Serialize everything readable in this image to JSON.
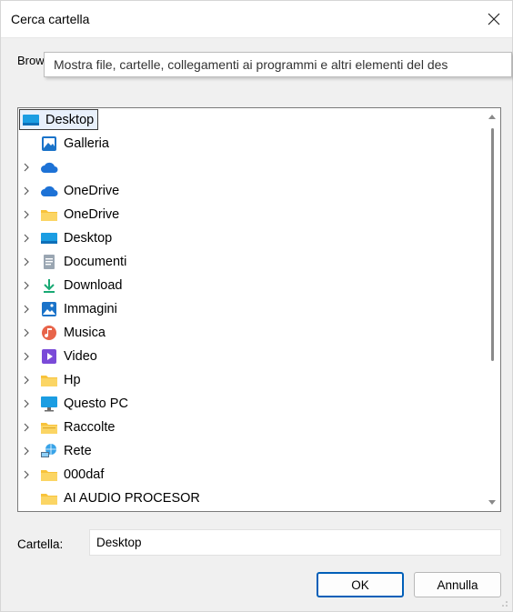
{
  "window": {
    "title": "Cerca cartella",
    "close_icon": "close-icon"
  },
  "prompt": "Browse For Folder",
  "tree": {
    "root": {
      "label": "Desktop",
      "icon": "desktop-icon",
      "selected": true
    },
    "items": [
      {
        "label": "Galleria",
        "icon": "gallery-icon",
        "expandable": false
      },
      {
        "label": "",
        "icon": "onedrive-cloud-icon",
        "expandable": true,
        "hidden_by_tooltip": true
      },
      {
        "label": "OneDrive",
        "icon": "onedrive-cloud-icon",
        "expandable": true
      },
      {
        "label": "OneDrive",
        "icon": "folder-icon",
        "expandable": true
      },
      {
        "label": "Desktop",
        "icon": "desktop-icon",
        "expandable": true
      },
      {
        "label": "Documenti",
        "icon": "documents-icon",
        "expandable": true
      },
      {
        "label": "Download",
        "icon": "download-icon",
        "expandable": true
      },
      {
        "label": "Immagini",
        "icon": "pictures-icon",
        "expandable": true
      },
      {
        "label": "Musica",
        "icon": "music-icon",
        "expandable": true
      },
      {
        "label": "Video",
        "icon": "video-icon",
        "expandable": true
      },
      {
        "label": "Hp",
        "icon": "folder-icon",
        "expandable": true
      },
      {
        "label": "Questo PC",
        "icon": "computer-icon",
        "expandable": true
      },
      {
        "label": "Raccolte",
        "icon": "libraries-icon",
        "expandable": true
      },
      {
        "label": "Rete",
        "icon": "network-icon",
        "expandable": true
      },
      {
        "label": "000daf",
        "icon": "folder-icon",
        "expandable": true
      },
      {
        "label": "AI AUDIO PROCESOR",
        "icon": "folder-icon",
        "expandable": false
      }
    ]
  },
  "tooltip": "Mostra file, cartelle, collegamenti ai programmi e altri elementi del des",
  "folder_field": {
    "label": "Cartella:",
    "value": "Desktop"
  },
  "buttons": {
    "ok": "OK",
    "cancel": "Annulla"
  },
  "colors": {
    "accent": "#005fb8",
    "folder": "#f8c33b",
    "onedrive": "#1d72d6"
  }
}
